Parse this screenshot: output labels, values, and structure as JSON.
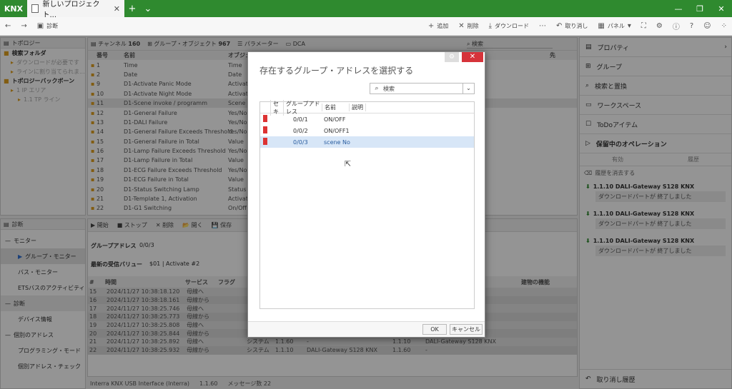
{
  "app": {
    "logo": "KNX",
    "tab_title": "新しいプロジェクト...",
    "new_tab": "+",
    "more": "⌄"
  },
  "toolbar": {
    "diagnostics": "診断",
    "add": "追加",
    "delete": "削除",
    "download": "ダウンロード",
    "undo": "取り消し",
    "panel": "パネル"
  },
  "left_top": {
    "title": "トポロジー",
    "items": [
      {
        "label": "検索フォルダ",
        "bold": true,
        "indent": 0
      },
      {
        "label": "ダウンロードが必要です",
        "bold": false,
        "indent": 1
      },
      {
        "label": "ラインに割り当てられま...",
        "bold": false,
        "indent": 1
      },
      {
        "label": "トポロジーバックボーン",
        "bold": true,
        "indent": 0
      },
      {
        "label": "1 IP エリア",
        "bold": false,
        "indent": 1
      },
      {
        "label": "1.1 TP ライン",
        "bold": false,
        "indent": 2
      }
    ]
  },
  "center_tabs": {
    "channels": "チャンネル",
    "channels_count": "160",
    "group_objects": "グループ・オブジェクト",
    "group_objects_count": "967",
    "parameters": "パラメーター",
    "dca": "DCA",
    "search": "検索"
  },
  "objects": {
    "col_number": "番号",
    "col_name": "名前",
    "col_object": "オブジェ",
    "col_dest": "先",
    "rows": [
      {
        "n": "1",
        "name": "Time",
        "obj": "Time"
      },
      {
        "n": "2",
        "name": "Date",
        "obj": "Date"
      },
      {
        "n": "9",
        "name": "D1-Activate Panic Mode",
        "obj": "Activate"
      },
      {
        "n": "10",
        "name": "D1-Activate Night Mode",
        "obj": "Activate"
      },
      {
        "n": "11",
        "name": "D1-Scene invoke / programm",
        "obj": "Scene N"
      },
      {
        "n": "12",
        "name": "D1-General Failure",
        "obj": "Yes/No"
      },
      {
        "n": "13",
        "name": "D1-DALI Failure",
        "obj": "Yes/No"
      },
      {
        "n": "14",
        "name": "D1-General Failure Exceeds Threshold",
        "obj": "Yes/No"
      },
      {
        "n": "15",
        "name": "D1-General Failure in Total",
        "obj": "Value"
      },
      {
        "n": "16",
        "name": "D1-Lamp Failure Exceeds Threshold",
        "obj": "Yes/No"
      },
      {
        "n": "17",
        "name": "D1-Lamp Failure in Total",
        "obj": "Value"
      },
      {
        "n": "18",
        "name": "D1-ECG Failure Exceeds Threshold",
        "obj": "Yes/No"
      },
      {
        "n": "19",
        "name": "D1-ECG Failure in Total",
        "obj": "Value"
      },
      {
        "n": "20",
        "name": "D1-Status Switching Lamp",
        "obj": "Status"
      },
      {
        "n": "21",
        "name": "D1-Template 1, Activation",
        "obj": "Activate"
      },
      {
        "n": "22",
        "name": "D1-G1 Switching",
        "obj": "On/Off"
      }
    ]
  },
  "diag_panel": {
    "title": "診断",
    "monitor": "モニター",
    "group_monitor": "グループ・モニター",
    "bus_monitor": "バス・モニター",
    "ets_activity": "ETSバスのアクティビティ",
    "diagnostics": "診断",
    "device_info": "デバイス情報",
    "individual_address": "個別のアドレス",
    "programming_mode": "プログラミング・モード",
    "address_check": "個別アドレス・チェック"
  },
  "monitor": {
    "start": "開始",
    "stop": "ストップ",
    "delete": "削除",
    "open": "開く",
    "save": "保存",
    "ga_label": "グループアドレス",
    "ga_value": "0/0/3",
    "last_label": "最新の受信バリュー",
    "last_value": "$01 | Activate #2",
    "col_hash": "#",
    "col_time": "時間",
    "col_service": "サービス",
    "col_flag": "フラグ",
    "col_func": "建物の機能",
    "rows": [
      {
        "n": "15",
        "t": "2024/11/27 10:38:18.120",
        "s": "母線へ",
        "sys": "",
        "a": "",
        "dev": "",
        "b": "",
        "d": "KNX"
      },
      {
        "n": "16",
        "t": "2024/11/27 10:38:18.161",
        "s": "母線から",
        "sys": "",
        "a": "",
        "dev": "",
        "b": "",
        "d": "KNX"
      },
      {
        "n": "17",
        "t": "2024/11/27 10:38:25.746",
        "s": "母線へ",
        "sys": "",
        "a": "",
        "dev": "",
        "b": "",
        "d": ""
      },
      {
        "n": "18",
        "t": "2024/11/27 10:38:25.773",
        "s": "母線から",
        "sys": "",
        "a": "",
        "dev": "",
        "b": "",
        "d": "KNX"
      },
      {
        "n": "19",
        "t": "2024/11/27 10:38:25.808",
        "s": "母線へ",
        "sys": "",
        "a": "",
        "dev": "",
        "b": "",
        "d": "KNX"
      },
      {
        "n": "20",
        "t": "2024/11/27 10:38:25.844",
        "s": "母線から",
        "sys": "システム",
        "a": "1.1.10",
        "dev": "DALI-Gateway S128 KNX",
        "b": "1.1.60",
        "d": "-"
      },
      {
        "n": "21",
        "t": "2024/11/27 10:38:25.892",
        "s": "母線へ",
        "sys": "システム",
        "a": "1.1.60",
        "dev": "-",
        "b": "1.1.10",
        "d": "DALI-Gateway S128 KNX"
      },
      {
        "n": "22",
        "t": "2024/11/27 10:38:25.932",
        "s": "母線から",
        "sys": "システム",
        "a": "1.1.10",
        "dev": "DALI-Gateway S128 KNX",
        "b": "1.1.60",
        "d": "-"
      }
    ]
  },
  "statusbar": {
    "interface": "Interra KNX USB Interface (Interra)",
    "address": "1.1.60",
    "messages": "メッセージ数 22"
  },
  "right": {
    "properties": "プロパティ",
    "groups": "グループ",
    "search_replace": "検索と置換",
    "workspace": "ワークスペース",
    "todo": "ToDoアイテム",
    "pending": "保留中のオペレーション",
    "valid": "有効",
    "history_tab": "履歴",
    "clear_history": "履歴を消去する",
    "ops": [
      {
        "title": "1.1.10 DALI-Gateway S128 KNX",
        "sub": "ダウンロードパートが 終了しました"
      },
      {
        "title": "1.1.10 DALI-Gateway S128 KNX",
        "sub": "ダウンロードパートが 終了しました"
      },
      {
        "title": "1.1.10 DALI-Gateway S128 KNX",
        "sub": "ダウンロードパートが 終了しました"
      }
    ],
    "undo_history": "取り消し履歴"
  },
  "dialog": {
    "title": "存在するグループ・アドレスを選択する",
    "search_placeholder": "検索",
    "col_seki": "セキ",
    "col_address": "グループアドレス",
    "col_name": "名前",
    "col_desc": "説明",
    "rows": [
      {
        "addr": "0/0/1",
        "name": "ON/OFF",
        "selected": false
      },
      {
        "addr": "0/0/2",
        "name": "ON/OFF1",
        "selected": false
      },
      {
        "addr": "0/0/3",
        "name": "scene No",
        "selected": true
      }
    ],
    "ok": "OK",
    "cancel": "キャンセル"
  }
}
